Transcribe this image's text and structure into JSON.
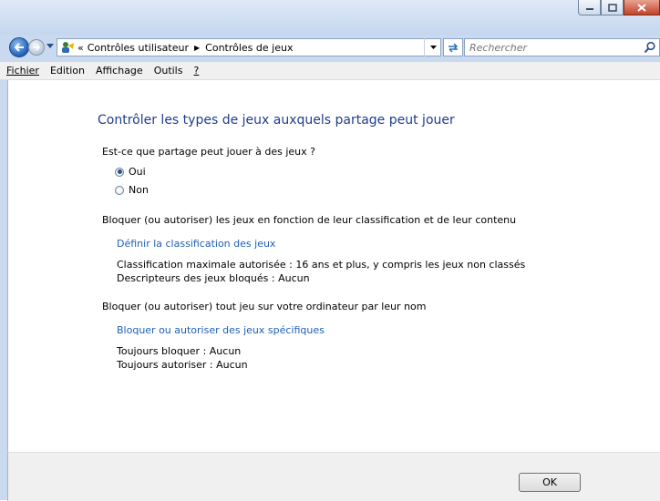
{
  "window": {
    "address": {
      "overflow": "«",
      "crumbs": [
        "Contrôles utilisateur",
        "Contrôles de jeux"
      ]
    },
    "search_placeholder": "Rechercher"
  },
  "menu": [
    "Fichier",
    "Edition",
    "Affichage",
    "Outils",
    "?"
  ],
  "content": {
    "title": "Contrôler les types de jeux auxquels partage peut jouer",
    "question": "Est-ce que partage peut jouer à des jeux ?",
    "options": [
      {
        "label": "Oui",
        "selected": true
      },
      {
        "label": "Non",
        "selected": false
      }
    ],
    "section1": {
      "heading": "Bloquer (ou autoriser) les jeux en fonction de leur classification et de leur contenu",
      "link": "Définir la classification des jeux",
      "lines": [
        "Classification maximale autorisée :  16 ans et plus, y compris les jeux non classés",
        "Descripteurs des jeux bloqués :  Aucun"
      ]
    },
    "section2": {
      "heading": "Bloquer (ou autoriser) tout jeu sur votre ordinateur par leur nom",
      "link": "Bloquer ou autoriser des jeux spécifiques",
      "lines": [
        "Toujours bloquer :  Aucun",
        "Toujours autoriser :  Aucun"
      ]
    }
  },
  "footer": {
    "ok_label": "OK"
  },
  "colors": {
    "link": "#1f5fb5",
    "title": "#1e3d8c",
    "close_button": "#c4412a"
  }
}
